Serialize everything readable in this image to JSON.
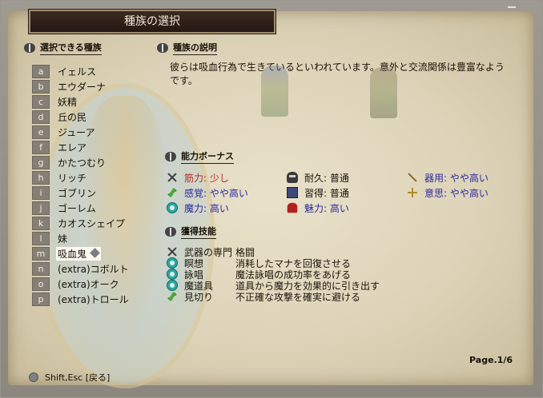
{
  "window": {
    "title": "種族の選択",
    "page_label": "Page.1/6",
    "footer_hint": "Shift,Esc [戻る]"
  },
  "race_list": {
    "heading": "選択できる種族",
    "selected_index": 12,
    "items": [
      {
        "key": "a",
        "name": "イェルス"
      },
      {
        "key": "b",
        "name": "エウダーナ"
      },
      {
        "key": "c",
        "name": "妖精"
      },
      {
        "key": "d",
        "name": "丘の民"
      },
      {
        "key": "e",
        "name": "ジューア"
      },
      {
        "key": "f",
        "name": "エレア"
      },
      {
        "key": "g",
        "name": "かたつむり"
      },
      {
        "key": "h",
        "name": "リッチ"
      },
      {
        "key": "i",
        "name": "ゴブリン"
      },
      {
        "key": "j",
        "name": "ゴーレム"
      },
      {
        "key": "k",
        "name": "カオスシェイプ"
      },
      {
        "key": "l",
        "name": "妹"
      },
      {
        "key": "m",
        "name": "吸血鬼"
      },
      {
        "key": "n",
        "name": "(extra)コボルト"
      },
      {
        "key": "o",
        "name": "(extra)オーク"
      },
      {
        "key": "p",
        "name": "(extra)トロール"
      }
    ]
  },
  "description": {
    "heading": "種族の説明",
    "text": "彼らは吸血行為で生きているといわれています。意外と交流関係は豊富なようです。"
  },
  "bonus": {
    "heading": "能力ボーナス",
    "items": [
      {
        "icon": "sword-icon",
        "label": "筋力: 少し",
        "color": "#b0302a"
      },
      {
        "icon": "skull-icon",
        "label": "耐久: 普通",
        "color": "#1a1208"
      },
      {
        "icon": "tool-icon",
        "label": "器用: やや高い",
        "color": "#2a2aa0"
      },
      {
        "icon": "leaf-icon",
        "label": "感覚: やや高い",
        "color": "#2a2aa0"
      },
      {
        "icon": "book-icon",
        "label": "習得: 普通",
        "color": "#1a1208"
      },
      {
        "icon": "spark-icon",
        "label": "意思: やや高い",
        "color": "#2a2aa0"
      },
      {
        "icon": "magic-circle-icon",
        "label": "魔力: 高い",
        "color": "#2a2aa0"
      },
      {
        "icon": "heart-icon",
        "label": "魅力: 高い",
        "color": "#2a2aa0"
      }
    ]
  },
  "skills": {
    "heading": "獲得技能",
    "items": [
      {
        "icon": "sword-icon",
        "name": "武器の専門",
        "desc": "格闘"
      },
      {
        "icon": "magic-circle-icon",
        "name": "瞑想",
        "desc": "消耗したマナを回復させる"
      },
      {
        "icon": "magic-circle-icon",
        "name": "詠唱",
        "desc": "魔法詠唱の成功率をあげる"
      },
      {
        "icon": "magic-circle-icon",
        "name": "魔道具",
        "desc": "道具から魔力を効果的に引き出す"
      },
      {
        "icon": "leaf-icon",
        "name": "見切り",
        "desc": "不正確な攻撃を確実に避ける"
      }
    ]
  }
}
